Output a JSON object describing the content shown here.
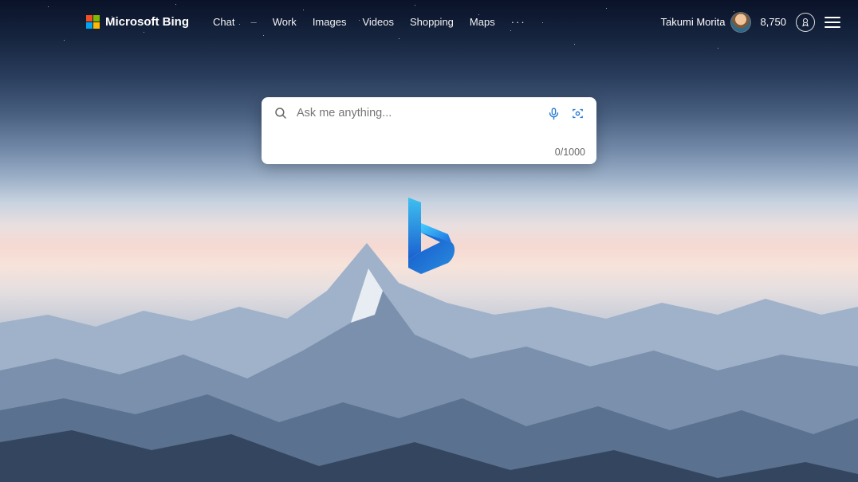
{
  "header": {
    "brand": "Microsoft Bing",
    "nav": {
      "chat": "Chat",
      "work": "Work",
      "images": "Images",
      "videos": "Videos",
      "shopping": "Shopping",
      "maps": "Maps",
      "more": "···"
    },
    "user_name": "Takumi Morita",
    "points": "8,750"
  },
  "search": {
    "placeholder": "Ask me anything...",
    "value": "",
    "counter": "0/1000"
  }
}
